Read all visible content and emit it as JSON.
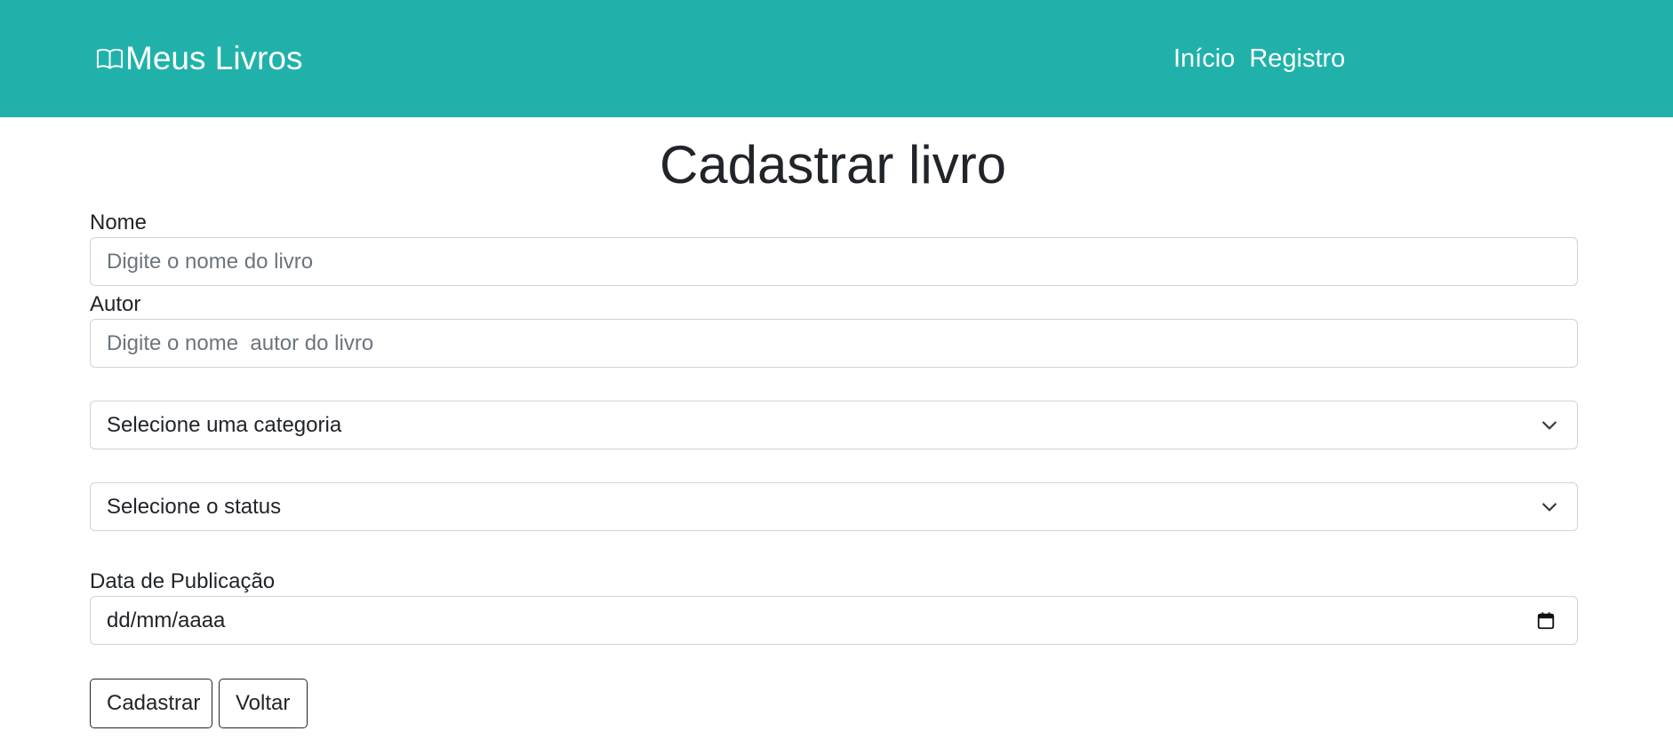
{
  "navbar": {
    "brand": "Meus Livros",
    "brand_icon": "book-open-icon",
    "links": [
      "Início",
      "Registro"
    ],
    "background_color": "#20b2aa"
  },
  "page": {
    "title": "Cadastrar livro"
  },
  "form": {
    "nome": {
      "label": "Nome",
      "placeholder": "Digite o nome do livro"
    },
    "autor": {
      "label": "Autor",
      "placeholder": "Digite o nome  autor do livro"
    },
    "categoria": {
      "selected": "Selecione uma categoria"
    },
    "status": {
      "selected": "Selecione o status"
    },
    "data_publicacao": {
      "label": "Data de Publicação",
      "value": "dd/mm/aaaa"
    },
    "buttons": {
      "submit": "Cadastrar",
      "back": "Voltar"
    }
  }
}
